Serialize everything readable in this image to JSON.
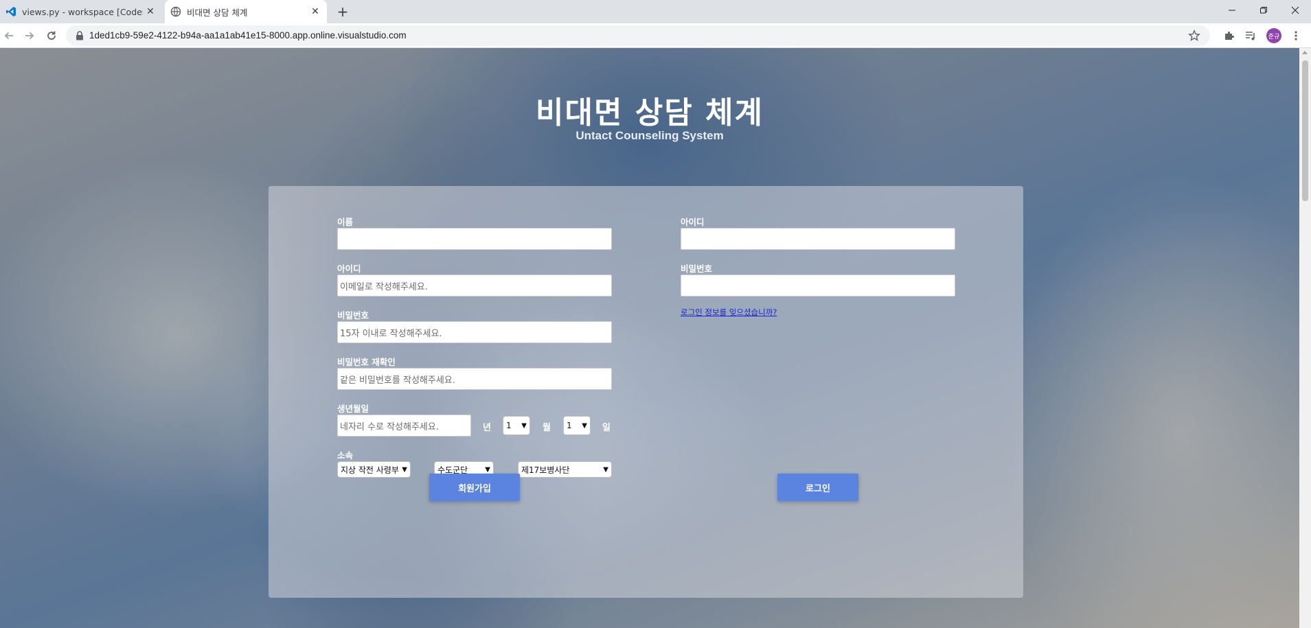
{
  "browser": {
    "tabs": [
      {
        "title": "views.py - workspace [Codespaces]",
        "active": false
      },
      {
        "title": "비대면 상담 체계",
        "active": true
      }
    ],
    "url": "1ded1cb9-59e2-4122-b94a-aa1a1ab41e15-8000.app.online.visualstudio.com",
    "avatar_text": "준규"
  },
  "page": {
    "title": "비대면 상담 체계",
    "subtitle": "Untact Counseling System",
    "signup": {
      "name_label": "이름",
      "id_label": "아이디",
      "id_placeholder": "이메일로 작성해주세요.",
      "pw_label": "비밀번호",
      "pw_placeholder": "15자 이내로 작성해주세요.",
      "pw_confirm_label": "비밀번호 재확인",
      "pw_confirm_placeholder": "같은 비밀번호를  작성해주세요.",
      "birth_label": "생년월일",
      "year_placeholder": "네자리 수로 작성해주세요.",
      "year_unit": "년",
      "month_value": "1",
      "month_unit": "월",
      "day_value": "1",
      "day_unit": "일",
      "affiliation_label": "소속",
      "affiliation_1": "지상 작전 사령부",
      "affiliation_2": "수도군단",
      "affiliation_3": "제17보병사단",
      "submit_label": "회원가입"
    },
    "login": {
      "id_label": "아이디",
      "pw_label": "비밀번호",
      "forgot_link": "로그인 정보를 잊으셨습니까?",
      "submit_label": "로그인"
    }
  }
}
